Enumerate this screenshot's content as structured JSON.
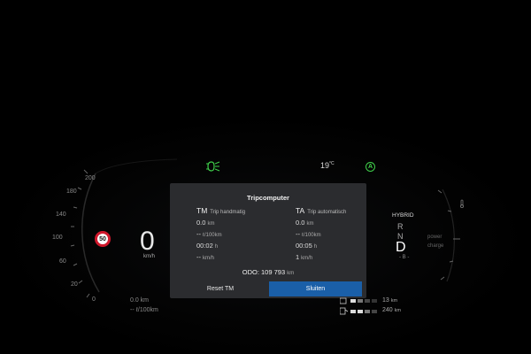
{
  "cluster": {
    "speedometer": {
      "ticks": [
        "200",
        "180",
        "140",
        "100",
        "60",
        "20",
        "0"
      ],
      "speed_value": "0",
      "speed_unit": "km/h",
      "speed_limit": "50"
    },
    "top_bar": {
      "temperature": "19",
      "temperature_unit": "°C",
      "auto_badge": "A",
      "headlight_icon": "low-beam-headlight-icon"
    },
    "drive": {
      "mode": "HYBRID",
      "gears": [
        "R",
        "N"
      ],
      "current_gear": "D",
      "power_label": "power",
      "charge_label": "charge"
    },
    "bottom_left": {
      "distance": "0.0 km",
      "consumption": "-- ℓ/100km"
    },
    "bottom_right": {
      "ev_range_value": "13",
      "ev_range_unit": "km",
      "fuel_range_value": "240",
      "fuel_range_unit": "km"
    }
  },
  "tripcomputer": {
    "title": "Tripcomputer",
    "manual": {
      "abbr": "TM",
      "label": "Trip handmatig",
      "distance": "0.0",
      "distance_unit": "km",
      "consumption": "--",
      "consumption_unit": "ℓ/100km",
      "time": "00:02",
      "time_unit": "h",
      "avg_speed": "--",
      "avg_speed_unit": "km/h"
    },
    "automatic": {
      "abbr": "TA",
      "label": "Trip automatisch",
      "distance": "0.0",
      "distance_unit": "km",
      "consumption": "--",
      "consumption_unit": "ℓ/100km",
      "time": "00:05",
      "time_unit": "h",
      "avg_speed": "1",
      "avg_speed_unit": "km/h"
    },
    "odo_label": "ODO:",
    "odo_value": "109 793",
    "odo_unit": "km",
    "reset_button": "Reset TM",
    "close_button": "Sluiten"
  },
  "colors": {
    "accent_blue": "#1a5fa8",
    "indicator_green": "#3fcf4a",
    "limit_red": "#d0182c"
  }
}
